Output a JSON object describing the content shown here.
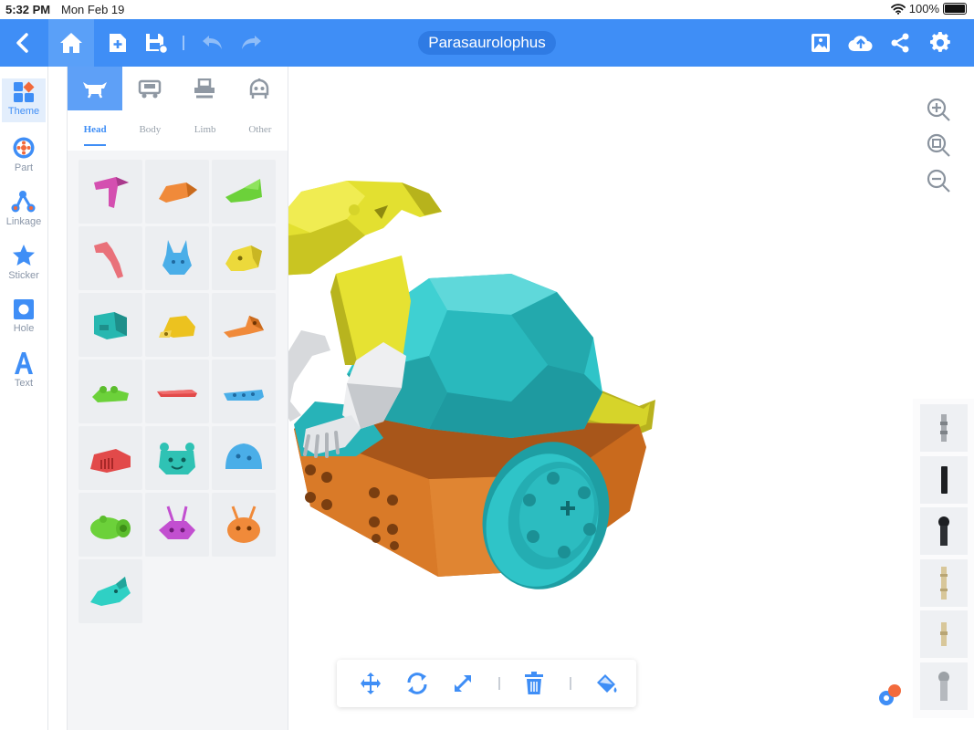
{
  "status_bar": {
    "time": "5:32 PM",
    "date": "Mon Feb 19",
    "battery": "100%"
  },
  "toolbar": {
    "title": "Parasaurolophus",
    "left_icons": [
      "back-icon",
      "home-icon",
      "new-file-icon",
      "save-icon",
      "undo-icon",
      "redo-icon"
    ],
    "right_icons": [
      "gallery-icon",
      "cloud-upload-icon",
      "share-icon",
      "settings-icon"
    ],
    "accent": "#3f8ef6"
  },
  "sidebar": {
    "items": [
      {
        "label": "Theme",
        "icon": "theme-icon",
        "active": true
      },
      {
        "label": "Part",
        "icon": "part-icon"
      },
      {
        "label": "Linkage",
        "icon": "linkage-icon"
      },
      {
        "label": "Sticker",
        "icon": "star-icon"
      },
      {
        "label": "Hole",
        "icon": "hole-icon"
      },
      {
        "label": "Text",
        "icon": "text-icon"
      }
    ]
  },
  "panel": {
    "category_tabs": [
      "animal-icon",
      "vehicle-icon",
      "machine-icon",
      "robot-icon"
    ],
    "sub_tabs": [
      "Head",
      "Body",
      "Limb",
      "Other"
    ],
    "active_sub_tab": "Head",
    "parts": [
      {
        "name": "pink-crest-head",
        "color": "#d44fb0"
      },
      {
        "name": "orange-beak-head",
        "color": "#f08a3a"
      },
      {
        "name": "green-croc-head",
        "color": "#6cd13a"
      },
      {
        "name": "pink-longneck-head",
        "color": "#e9717a"
      },
      {
        "name": "blue-bunny-head",
        "color": "#4aaee8"
      },
      {
        "name": "yellow-dino-head",
        "color": "#ecd93b"
      },
      {
        "name": "teal-robot-head",
        "color": "#27b7b0"
      },
      {
        "name": "yellow-shell-head",
        "color": "#ecc21f"
      },
      {
        "name": "orange-bird-head",
        "color": "#f08a3a"
      },
      {
        "name": "green-frog-head",
        "color": "#6cd13a"
      },
      {
        "name": "red-stick-head",
        "color": "#e24a4a"
      },
      {
        "name": "blue-flat-head",
        "color": "#4aaee8"
      },
      {
        "name": "red-grill-head",
        "color": "#e24a4a"
      },
      {
        "name": "teal-bear-head",
        "color": "#2fc2b4"
      },
      {
        "name": "blue-round-head",
        "color": "#4aaee8"
      },
      {
        "name": "green-snout-head",
        "color": "#6cd13a"
      },
      {
        "name": "purple-bug-head",
        "color": "#c24fd0"
      },
      {
        "name": "orange-antenna-head",
        "color": "#f08a3a"
      },
      {
        "name": "teal-dragon-head",
        "color": "#2fd0c4"
      }
    ]
  },
  "canvas": {
    "zoom_icons": [
      "zoom-in-icon",
      "zoom-fit-icon",
      "zoom-out-icon"
    ],
    "model_colors": {
      "head": "#d6d42a",
      "body": "#2fc4c8",
      "base": "#d97a28",
      "arm": "#d7d9dc"
    }
  },
  "bottom_toolbar": {
    "icons": [
      "move-icon",
      "rotate-icon",
      "scale-icon",
      "delete-icon",
      "paint-icon"
    ]
  },
  "connectors": {
    "items": [
      "gray-pin-connector",
      "black-beam-connector",
      "black-ball-connector",
      "tan-long-pin-connector",
      "tan-pin-connector",
      "gray-ball-pin-connector"
    ]
  }
}
